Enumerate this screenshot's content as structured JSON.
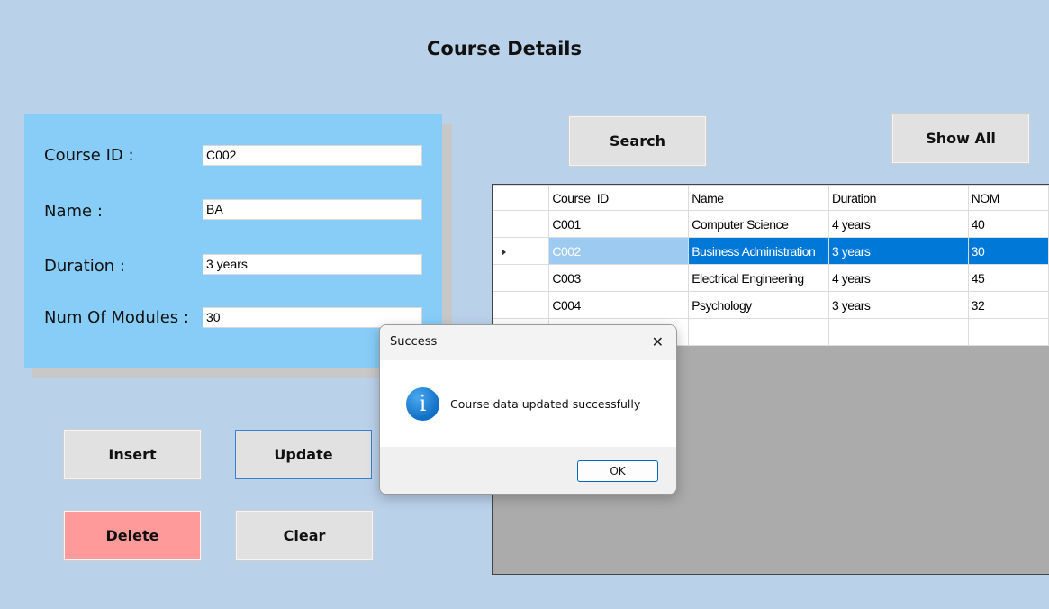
{
  "page": {
    "title": "Course Details"
  },
  "form": {
    "fields": [
      {
        "label": "Course ID :",
        "value": "C002"
      },
      {
        "label": "Name :",
        "value": "BA"
      },
      {
        "label": "Duration :",
        "value": "3 years"
      },
      {
        "label": "Num Of Modules :",
        "value": "30"
      }
    ]
  },
  "buttons": {
    "insert": "Insert",
    "update": "Update",
    "delete": "Delete",
    "clear": "Clear",
    "search": "Search",
    "show_all": "Show All"
  },
  "grid": {
    "columns": [
      "Course_ID",
      "Name",
      "Duration",
      "NOM"
    ],
    "rows": [
      [
        "C001",
        "Computer Science",
        "4 years",
        "40"
      ],
      [
        "C002",
        "Business Administration",
        "3 years",
        "30"
      ],
      [
        "C003",
        "Electrical Engineering",
        "4 years",
        "45"
      ],
      [
        "C004",
        "Psychology",
        "3 years",
        "32"
      ]
    ],
    "selected_row": "C002"
  },
  "dialog": {
    "title": "Success",
    "message": "Course data updated successfully",
    "ok_label": "OK",
    "icon": "info-icon",
    "close_icon": "close-icon"
  },
  "colors": {
    "background": "#bad1ea",
    "form_panel": "#87cdf8",
    "delete_button": "#ff9a9a",
    "selection": "#0078d7"
  }
}
